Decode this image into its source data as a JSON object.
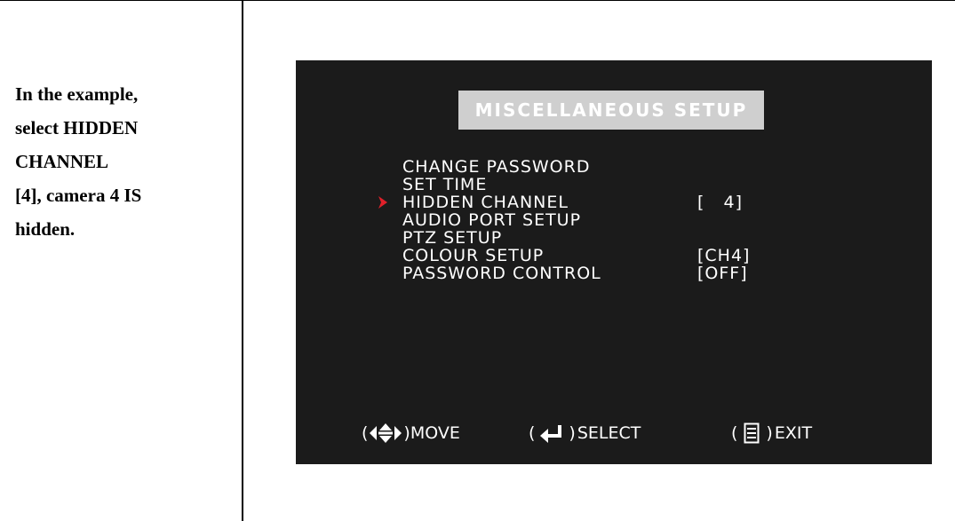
{
  "description": {
    "lines": [
      "In the example,",
      "select HIDDEN",
      "CHANNEL",
      "[4], camera 4 IS",
      "hidden."
    ]
  },
  "osd": {
    "title": "MISCELLANEOUS SETUP",
    "selected_item": "HIDDEN CHANNEL",
    "cursor_icon": "red-chevron-right-icon",
    "items": [
      {
        "label": "CHANGE PASSWORD",
        "value": ""
      },
      {
        "label": "SET TIME",
        "value": ""
      },
      {
        "label": "HIDDEN CHANNEL",
        "value": "[   4]"
      },
      {
        "label": "AUDIO PORT SETUP",
        "value": ""
      },
      {
        "label": "PTZ SETUP",
        "value": ""
      },
      {
        "label": "COLOUR SETUP",
        "value": "[CH4]"
      },
      {
        "label": "PASSWORD CONTROL",
        "value": "[OFF]"
      }
    ],
    "footer": {
      "move_label": "MOVE",
      "move_icon": "arrow-keys-icon",
      "select_label": "SELECT",
      "select_icon": "enter-key-icon",
      "exit_label": "EXIT",
      "exit_icon": "menu-key-icon"
    }
  },
  "colors": {
    "screen_background": "#1b1b1b",
    "title_background": "#cfcfcf",
    "cursor": "#e0202a",
    "text": "#ffffff"
  }
}
